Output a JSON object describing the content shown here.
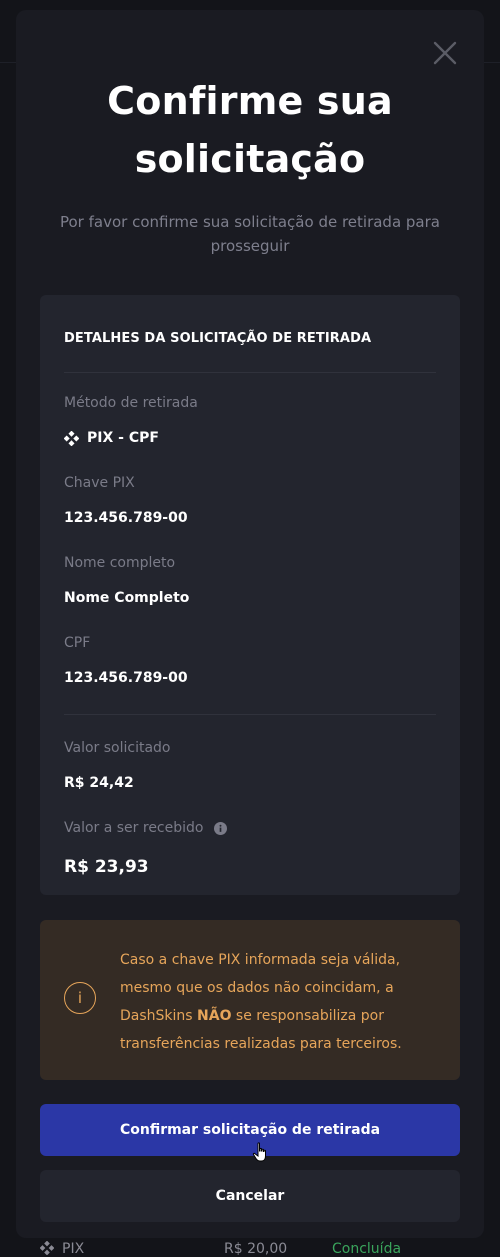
{
  "modal": {
    "title": "Confirme sua solicitação",
    "subtitle": "Por favor confirme sua solicitação de retirada para prosseguir"
  },
  "details": {
    "heading": "DETALHES DA SOLICITAÇÃO DE RETIRADA",
    "method_label": "Método de retirada",
    "method_value": "PIX - CPF",
    "method_icon": "pix-icon",
    "pix_key_label": "Chave PIX",
    "pix_key_value": "123.456.789-00",
    "name_label": "Nome completo",
    "name_value": "Nome Completo",
    "cpf_label": "CPF",
    "cpf_value": "123.456.789-00",
    "requested_label": "Valor solicitado",
    "requested_value": "R$ 24,42",
    "received_label": "Valor a ser recebido",
    "received_value": "R$ 23,93"
  },
  "warning": {
    "icon": "info-icon",
    "text_before": "Caso a chave PIX informada seja válida, mesmo que os dados não coincidam, a DashSkins ",
    "text_bold": "NÃO",
    "text_after": " se responsabiliza por transferências realizadas para terceiros."
  },
  "buttons": {
    "confirm_label": "Confirmar solicitação de retirada",
    "cancel_label": "Cancelar"
  },
  "background_row": {
    "method": "PIX",
    "amount": "R$ 20,00",
    "status": "Concluída"
  },
  "colors": {
    "accent": "#2b37a6",
    "warning": "#e6a55a",
    "success": "#3aa55c"
  }
}
